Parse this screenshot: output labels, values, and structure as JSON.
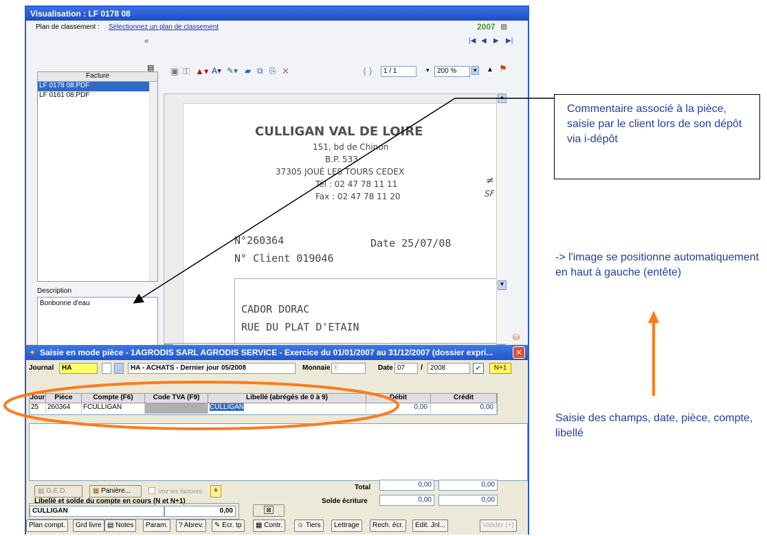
{
  "window_title": "Visualisation : LF 0178 08",
  "plan": {
    "label": "Plan de classement :",
    "link": "Sélectionnez un plan de classement",
    "year": "2007",
    "collapse": "«"
  },
  "facture_list": {
    "header": "Facture",
    "items": [
      "LF 0178 08.PDF",
      "LF 0161 08.PDF"
    ]
  },
  "description": {
    "label": "Description",
    "value": "Bonbonne d'eau"
  },
  "viewer": {
    "page": "1 / 1",
    "zoom": "200 %"
  },
  "document": {
    "company": "CULLIGAN VAL DE LOIRE",
    "address1": "151, bd de Chinon",
    "address2": "B.P. 533",
    "address3": "37305 JOUÉ LES TOURS CEDEX",
    "tel": "Tél : 02 47 78 11 11",
    "fax": "Fax : 02 47 78 11 20",
    "num": "N°260364",
    "date": "Date 25/07/08",
    "client": "N° Client 019046",
    "addr_a": "CADOR DORAC",
    "addr_b": "RUE DU PLAT D'ETAIN",
    "side1": "SF"
  },
  "saisie": {
    "title": "Saisie en mode pièce - 1AGRODIS SARL AGRODIS SERVICE - Exercice du 01/01/2007 au 31/12/2007 (dossier expri...",
    "journal_label": "Journal",
    "journal_code": "HA",
    "journal_name": "HA - ACHATS - Dernier jour 05/2008",
    "monnaie_label": "Monnaie",
    "monnaie_value": "E",
    "date_label": "Date",
    "month": "07",
    "year": "2008",
    "n1": "N+1",
    "columns": [
      "Jour",
      "Pièce",
      "Compte (F6)",
      "Code TVA (F9)",
      "Libellé (abrégés de 0 à 9)",
      "Débit",
      "Crédit"
    ],
    "row": {
      "jour": "25",
      "piece": "260364",
      "compte": "FCULLIGAN",
      "tva": "",
      "libelle": "CULLIGAN",
      "debit": "0,00",
      "credit": "0,00"
    }
  },
  "bottom": {
    "ged": "G.E.D.",
    "paniere": "Panière...",
    "voir": "Voir les factures",
    "total_label": "Total",
    "total_debit": "0,00",
    "total_credit": "0,00",
    "libelle_title": "Libellé et solde du compte en cours (N et N+1)",
    "libelle_value": "CULLIGAN",
    "solde_value": "0,00",
    "solde_label": "Solde écriture",
    "solde_debit": "0,00",
    "solde_credit": "0,00"
  },
  "buttons": [
    "Plan compt.",
    "Grd livre",
    "Notes",
    "Param.",
    "Abrev.",
    "Ecr. tp",
    "Contr.",
    "Tiers",
    "Lettrage",
    "Rech. écr.",
    "Edit. Jnl...",
    "Valider (+)"
  ],
  "annotations": {
    "note1": "Commentaire associé à la pièce, saisie par le client lors de son dépôt via i-dépôt",
    "note2": "-> l'image se positionne automatiquement en haut à gauche (entête)",
    "note3": "Saisie des champs, date, pièce,  compte, libellé"
  },
  "colors": {
    "accent": "#ff7a1a",
    "title_blue": "#1d4cc4",
    "note_text": "#2040a0"
  }
}
